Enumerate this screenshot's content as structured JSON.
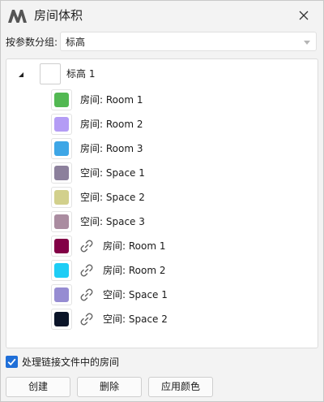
{
  "window": {
    "title": "房间体积"
  },
  "group": {
    "label": "按参数分组:",
    "selected": "标高"
  },
  "tree": {
    "root": {
      "label": "标高 1"
    },
    "items": [
      {
        "label": "房间: Room 1",
        "color": "#52b852",
        "linked": false
      },
      {
        "label": "房间: Room 2",
        "color": "#b49cf5",
        "linked": false
      },
      {
        "label": "房间: Room 3",
        "color": "#3ea6e6",
        "linked": false
      },
      {
        "label": "空间: Space 1",
        "color": "#8c809c",
        "linked": false
      },
      {
        "label": "空间: Space 2",
        "color": "#d2d08c",
        "linked": false
      },
      {
        "label": "空间: Space 3",
        "color": "#aa8ca0",
        "linked": false
      },
      {
        "label": "房间: Room 1",
        "color": "#820046",
        "linked": true
      },
      {
        "label": "房间: Room 2",
        "color": "#1ecdf5",
        "linked": true
      },
      {
        "label": "空间: Space 1",
        "color": "#968cd2",
        "linked": true
      },
      {
        "label": "空间: Space 2",
        "color": "#0a1428",
        "linked": true
      }
    ]
  },
  "options": {
    "include_linked_label": "处理链接文件中的房间",
    "include_linked_checked": true
  },
  "buttons": {
    "create": "创建",
    "delete": "删除",
    "apply": "应用颜色"
  },
  "icons": {
    "logo": "app-logo-icon",
    "close": "close-icon",
    "link": "link-icon",
    "expander": "expander-icon",
    "check": "checkmark-icon"
  },
  "colors": {
    "accent": "#1f6fd8",
    "logo": "#555555"
  }
}
